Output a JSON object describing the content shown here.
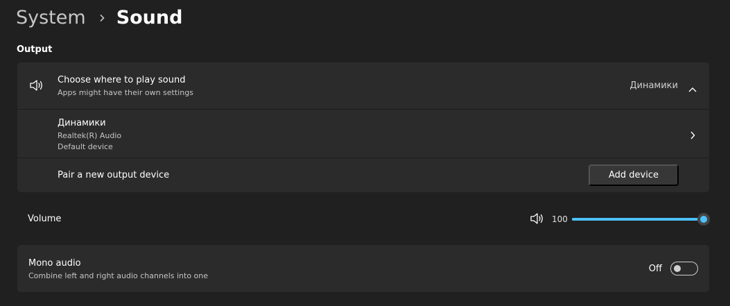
{
  "breadcrumb": {
    "parent": "System",
    "current": "Sound"
  },
  "output": {
    "section_label": "Output",
    "choose": {
      "icon": "speaker-icon",
      "title": "Choose where to play sound",
      "subtitle": "Apps might have their own settings",
      "selected": "Динамики",
      "expanded": true
    },
    "device": {
      "name": "Динамики",
      "driver": "Realtek(R) Audio",
      "status": "Default device"
    },
    "pair": {
      "label": "Pair a new output device",
      "button": "Add device"
    }
  },
  "volume": {
    "label": "Volume",
    "icon": "speaker-volume-icon",
    "value": "100",
    "level": 100
  },
  "mono": {
    "title": "Mono audio",
    "subtitle": "Combine left and right audio channels into one",
    "state": "Off",
    "on": false
  },
  "colors": {
    "accent": "#4cc2ff",
    "background": "#202020",
    "card": "#2b2b2b"
  }
}
